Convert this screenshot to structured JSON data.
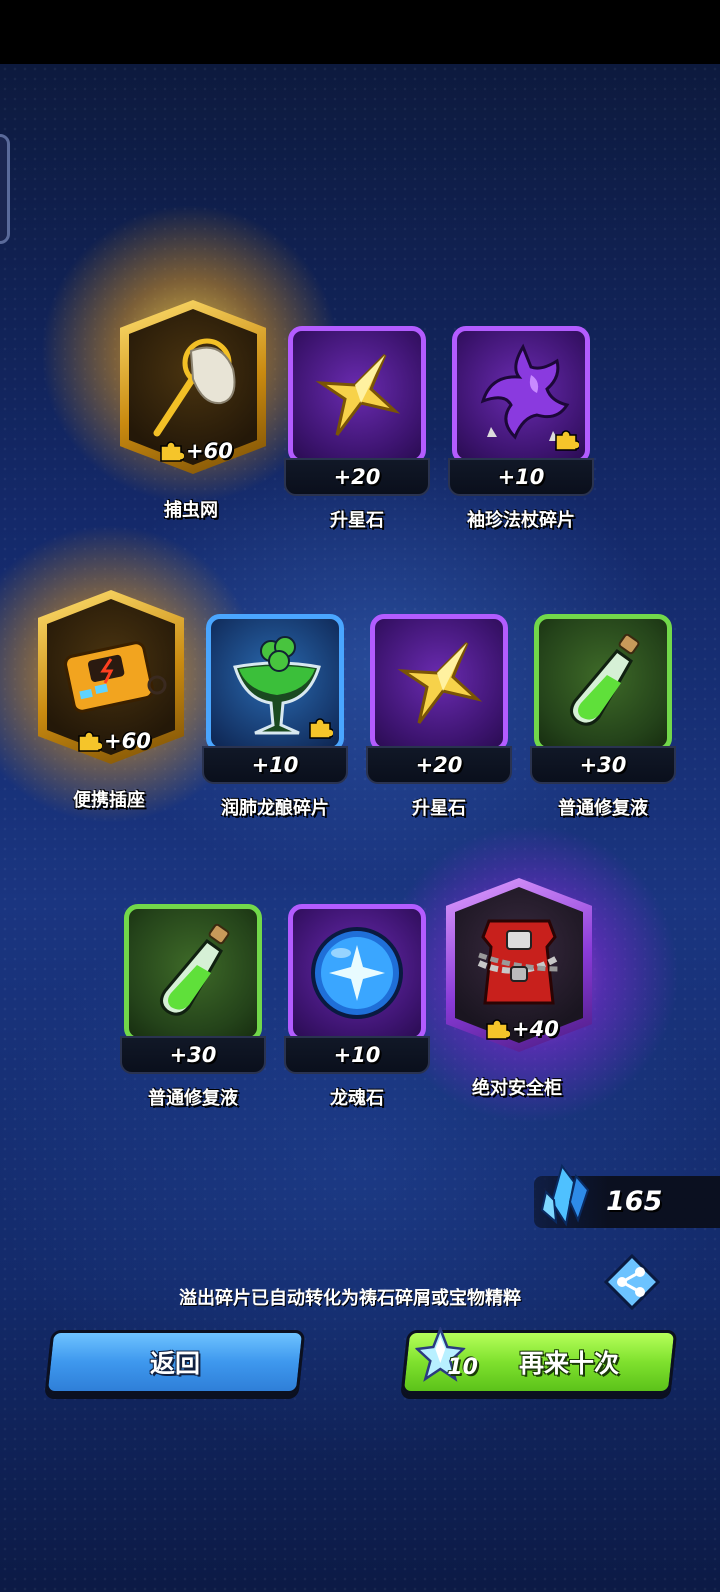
{
  "rewards": [
    {
      "name": "捕虫网",
      "qty": "+60",
      "rarity": "legendary",
      "icon": "bug-net-icon"
    },
    {
      "name": "升星石",
      "qty": "+20",
      "rarity": "epic",
      "icon": "gold-star-stone-icon"
    },
    {
      "name": "袖珍法杖碎片",
      "qty": "+10",
      "rarity": "epic",
      "icon": "spiky-dragon-icon",
      "fragment": true
    },
    {
      "name": "便携插座",
      "qty": "+60",
      "rarity": "legendary",
      "icon": "portable-socket-icon"
    },
    {
      "name": "润肺龙酿碎片",
      "qty": "+10",
      "rarity": "rare",
      "icon": "green-cocktail-icon",
      "fragment": true
    },
    {
      "name": "升星石",
      "qty": "+20",
      "rarity": "epic",
      "icon": "gold-star-stone-icon"
    },
    {
      "name": "普通修复液",
      "qty": "+30",
      "rarity": "uncommon",
      "icon": "green-potion-icon"
    },
    {
      "name": "普通修复液",
      "qty": "+30",
      "rarity": "uncommon",
      "icon": "green-potion-icon"
    },
    {
      "name": "龙魂石",
      "qty": "+10",
      "rarity": "epic",
      "icon": "blue-soul-orb-icon"
    },
    {
      "name": "绝对安全柜",
      "qty": "+40",
      "rarity": "legendary-purple",
      "icon": "chained-safe-icon"
    }
  ],
  "currency": {
    "amount": "165",
    "icon": "blue-crystal-icon"
  },
  "notice": "溢出碎片已自动转化为祷石碎屑或宝物精粹",
  "buttons": {
    "back": "返回",
    "again": "再来十次",
    "again_cost": "10"
  },
  "colors": {
    "epic": "#b35cff",
    "rare": "#4aa6ff",
    "uncommon": "#72d84a",
    "legendary": "#f0b020",
    "back_button": "#3e98ee",
    "again_button": "#7fe12e"
  }
}
